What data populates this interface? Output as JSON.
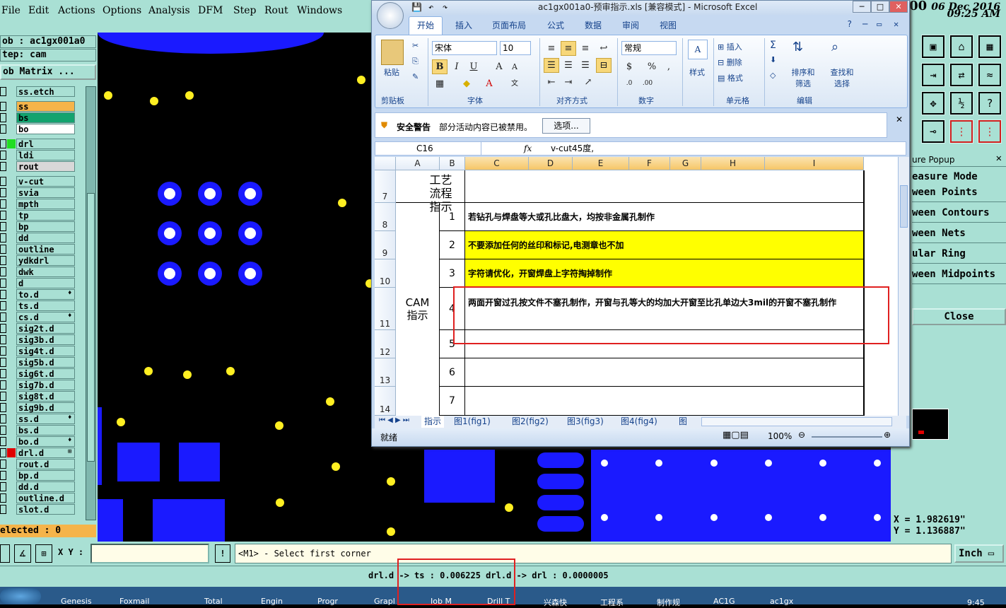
{
  "genesis": {
    "menu": [
      "File",
      "Edit",
      "Actions",
      "Options",
      "Analysis",
      "DFM",
      "Step",
      "Rout",
      "Windows"
    ],
    "clock_date": "06 Dec 2016",
    "clock_time": "09:25 AM",
    "clock_prefix": "00",
    "job_line": "ob : ac1gx001a0",
    "step_line": "tep: cam",
    "job_matrix_label": "ob Matrix ...",
    "layers": [
      {
        "name": "ss.etch",
        "color": "#a9e0d4",
        "mark": ""
      },
      {
        "name": "ss",
        "color": "#f5b44a",
        "mark": ""
      },
      {
        "name": "bs",
        "color": "#13a36e",
        "mark": ""
      },
      {
        "name": "bo",
        "color": "#ffffff",
        "mark": ""
      },
      {
        "name": "drl",
        "color": "#a9e0d4",
        "mark": ""
      },
      {
        "name": "ldi",
        "color": "#a9e0d4",
        "mark": ""
      },
      {
        "name": "rout",
        "color": "#d8d8d8",
        "mark": ""
      },
      {
        "name": "v-cut",
        "color": "#a9e0d4",
        "mark": ""
      },
      {
        "name": "svia",
        "color": "#a9e0d4",
        "mark": ""
      },
      {
        "name": "mpth",
        "color": "#a9e0d4",
        "mark": ""
      },
      {
        "name": "tp",
        "color": "#a9e0d4",
        "mark": ""
      },
      {
        "name": "bp",
        "color": "#a9e0d4",
        "mark": ""
      },
      {
        "name": "dd",
        "color": "#a9e0d4",
        "mark": ""
      },
      {
        "name": "outline",
        "color": "#a9e0d4",
        "mark": ""
      },
      {
        "name": "ydkdrl",
        "color": "#a9e0d4",
        "mark": ""
      },
      {
        "name": "dwk",
        "color": "#a9e0d4",
        "mark": ""
      },
      {
        "name": "d",
        "color": "#a9e0d4",
        "mark": ""
      },
      {
        "name": "to.d",
        "color": "#a9e0d4",
        "mark": "♦"
      },
      {
        "name": "ts.d",
        "color": "#a9e0d4",
        "mark": ""
      },
      {
        "name": "cs.d",
        "color": "#a9e0d4",
        "mark": "♦"
      },
      {
        "name": "sig2t.d",
        "color": "#a9e0d4",
        "mark": ""
      },
      {
        "name": "sig3b.d",
        "color": "#a9e0d4",
        "mark": ""
      },
      {
        "name": "sig4t.d",
        "color": "#a9e0d4",
        "mark": ""
      },
      {
        "name": "sig5b.d",
        "color": "#a9e0d4",
        "mark": ""
      },
      {
        "name": "sig6t.d",
        "color": "#a9e0d4",
        "mark": ""
      },
      {
        "name": "sig7b.d",
        "color": "#a9e0d4",
        "mark": ""
      },
      {
        "name": "sig8t.d",
        "color": "#a9e0d4",
        "mark": ""
      },
      {
        "name": "sig9b.d",
        "color": "#a9e0d4",
        "mark": ""
      },
      {
        "name": "ss.d",
        "color": "#a9e0d4",
        "mark": "♦"
      },
      {
        "name": "bs.d",
        "color": "#a9e0d4",
        "mark": ""
      },
      {
        "name": "bo.d",
        "color": "#a9e0d4",
        "mark": "♦"
      },
      {
        "name": "drl.d",
        "color": "#a9e0d4",
        "mark": "⊞"
      },
      {
        "name": "rout.d",
        "color": "#a9e0d4",
        "mark": ""
      },
      {
        "name": "bp.d",
        "color": "#a9e0d4",
        "mark": ""
      },
      {
        "name": "dd.d",
        "color": "#a9e0d4",
        "mark": ""
      },
      {
        "name": "outline.d",
        "color": "#a9e0d4",
        "mark": ""
      },
      {
        "name": "slot.d",
        "color": "#a9e0d4",
        "mark": ""
      }
    ],
    "selected_label": "elected : 0",
    "measure_title": "ure Popup",
    "measure_items": [
      "easure Mode",
      "ween Points",
      "ween Contours",
      "ween Nets",
      "ular Ring",
      "ween Midpoints"
    ],
    "close_label": "Close",
    "coord_x": "X = 1.982619\"",
    "coord_y": "Y = 1.136887\"",
    "xy_label": "X Y :",
    "prompt": "<M1> - Select first corner",
    "units": "Inch",
    "status_line": "drl.d -> ts : 0.006225   drl.d -> drl : 0.0000005",
    "taskbar": [
      "Genesis",
      "Foxmail",
      "",
      "Total",
      "Engin",
      "Progr",
      "Grapl",
      "Job M",
      "Drill T",
      "兴森快",
      "工程系",
      "制作规",
      "AC1G",
      "ac1gx"
    ],
    "taskbar_time": "9:45"
  },
  "excel": {
    "title": "ac1gx001a0-预审指示.xls  [兼容模式] - Microsoft Excel",
    "tabs": [
      "开始",
      "插入",
      "页面布局",
      "公式",
      "数据",
      "审阅",
      "视图"
    ],
    "groups": [
      "剪贴板",
      "字体",
      "对齐方式",
      "数字",
      "样式",
      "单元格",
      "编辑"
    ],
    "paste_label": "粘贴",
    "font_name": "宋体",
    "font_size": "10",
    "number_format": "常规",
    "style_label": "样式",
    "cells_btns": [
      "插入",
      "删除",
      "格式"
    ],
    "edit_btns": [
      "排序和筛选",
      "查找和选择"
    ],
    "security_label": "安全警告",
    "security_text": "部分活动内容已被禁用。",
    "options_btn": "选项...",
    "name_box": "C16",
    "formula": "v-cut45度,",
    "columns": [
      "A",
      "B",
      "C",
      "D",
      "E",
      "F",
      "G",
      "H",
      "I"
    ],
    "rows": [
      {
        "num": "7",
        "label": "",
        "text": ""
      },
      {
        "num": "8",
        "label": "1",
        "text": "若钻孔与焊盘等大或孔比盘大，均按非金属孔制作"
      },
      {
        "num": "9",
        "label": "2",
        "text": "不要添加任何的丝印和标记,电测章也不加"
      },
      {
        "num": "10",
        "label": "3",
        "text": "字符请优化，开窗焊盘上字符掏掉制作"
      },
      {
        "num": "11",
        "label": "4",
        "text": "两面开窗过孔按文件不塞孔制作，开窗与孔等大的均加大开窗至比孔单边大3mil的开窗不塞孔制作"
      },
      {
        "num": "12",
        "label": "5",
        "text": ""
      },
      {
        "num": "13",
        "label": "6",
        "text": ""
      },
      {
        "num": "14",
        "label": "7",
        "text": ""
      }
    ],
    "process_label": "工艺流程指示",
    "cam_label": "CAM指示",
    "sheets": [
      "指示",
      "图1(fig1)",
      "图2(fig2)",
      "图3(fig3)",
      "图4(fig4)",
      "图"
    ],
    "status": "就绪",
    "zoom": "100%"
  }
}
